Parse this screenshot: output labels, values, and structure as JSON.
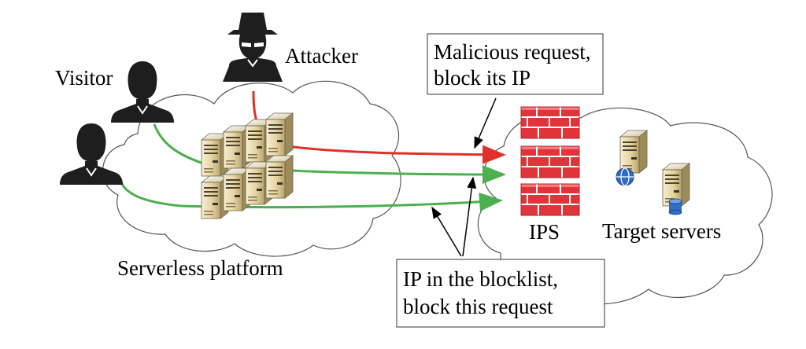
{
  "labels": {
    "visitor": "Visitor",
    "attacker": "Attacker",
    "ips": "IPS",
    "target_servers": "Target servers",
    "serverless_platform": "Serverless platform"
  },
  "callouts": {
    "malicious_line1": "Malicious request,",
    "malicious_line2": "block its IP",
    "blocklist_line1": "IP in the blocklist,",
    "blocklist_line2": "block this request"
  },
  "colors": {
    "malicious_flow": "#e0302a",
    "legit_flow": "#4caf50",
    "firewall": "#e0333a",
    "person": "#1e1e1e",
    "server_body": "#ead9a8"
  },
  "icons": [
    "user-icon",
    "hacker-icon",
    "server-icon",
    "firewall-icon",
    "globe-icon",
    "database-icon"
  ]
}
